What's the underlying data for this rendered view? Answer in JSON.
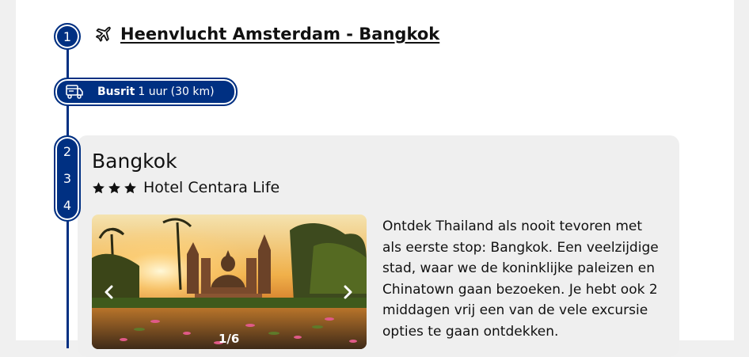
{
  "itinerary": {
    "step1": {
      "number": "1",
      "flight_label": "Heenvlucht Amsterdam - Bangkok"
    },
    "transfer": {
      "type": "Busrit",
      "detail": "1 uur (30 km)"
    },
    "stop": {
      "days": [
        "2",
        "3",
        "4"
      ],
      "city": "Bangkok",
      "hotel_stars": 3,
      "hotel_name": "Hotel Centara Life",
      "gallery_counter": "1/6",
      "description": "Ontdek Thailand als nooit tevoren met als eerste stop: Bangkok. Een veelzijdige stad, waar we de koninklijke paleizen en Chinatown gaan bezoeken. Je hebt ook 2 middagen vrij een van de vele excursie opties te gaan ontdekken."
    }
  },
  "icons": {
    "flight": "airplane-icon",
    "bus": "bus-icon",
    "star": "star-icon",
    "prev": "chevron-left-icon",
    "next": "chevron-right-icon"
  },
  "colors": {
    "accent": "#003082",
    "card_bg": "#efefef",
    "page_bg": "#f0f0f0"
  }
}
